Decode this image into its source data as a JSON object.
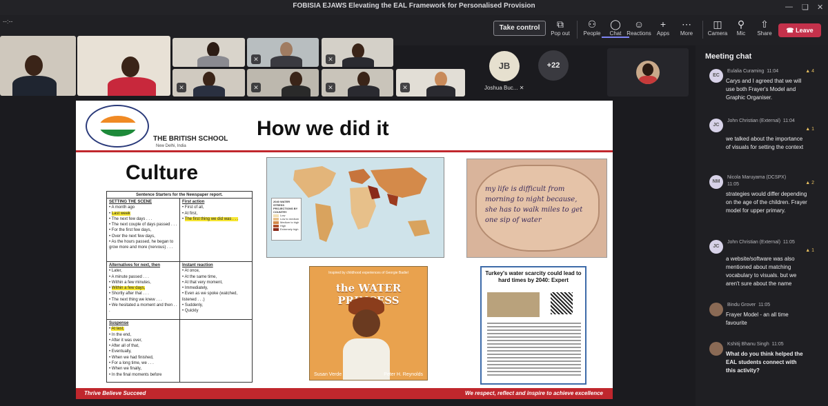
{
  "window": {
    "title": "FOBISIA EJAWS Elevating the EAL Framework for Personalised Provision",
    "timer": "--:--"
  },
  "toolbar": {
    "take_control": "Take control",
    "popout": "Pop out",
    "people": "People",
    "chat": "Chat",
    "reactions": "Reactions",
    "apps": "Apps",
    "more": "More",
    "camera": "Camera",
    "mic": "Mic",
    "share": "Share",
    "leave": "Leave"
  },
  "participants": {
    "jb_initials": "JB",
    "jb_name": "Joshua Buc...",
    "overflow_count": "+22"
  },
  "slide": {
    "school_name": "THE BRITISH SCHOOL",
    "school_location": "New Delhi, India",
    "title": "How we did it",
    "section": "Culture",
    "starters_header": "Sentence Starters for the Newspaper report.",
    "cells": {
      "setting_scene_title": "SETTING THE SCENE",
      "setting_scene_items": [
        "A month ago",
        "Last week",
        "The next few days . . .",
        "The next couple of days passed . . .",
        "For the first few days,",
        "Over the next few days,",
        "As the hours passed, he began to grow more and more (nervous) . . ."
      ],
      "first_action_title": "First action",
      "first_action_items": [
        "First of all,",
        "At first,",
        "The first thing we did was . . ."
      ],
      "alternatives_title": "Alternatives for next, then",
      "alternatives_items": [
        "Later,",
        "A minute passed . . .",
        "Within a few minutes,",
        "Within a few days,",
        "Shortly after that . . .",
        "The next thing we knew . . .",
        "We hesitated a moment and then . . ."
      ],
      "instant_title": "Instant reaction",
      "instant_items": [
        "At once,",
        "At the same time,",
        "At that very moment,",
        "Immediately,",
        "Even as we spoke (watched, listened . . .)",
        "Suddenly,",
        "Quickly"
      ],
      "suspense_title": "Suspense",
      "suspense_items": [
        "At last,",
        "In the end,",
        "After it was over,",
        "After all of that,",
        "Eventually,",
        "When we had finished,",
        "For a long time, we . . .",
        "When we finally,",
        "In the final moments before"
      ]
    },
    "map_legend_title": "2040 WATER STRESS PROJECTIONS BY COUNTRY",
    "map_legend_items": [
      "Low",
      "Low to medium",
      "Medium to high",
      "High",
      "Extremely high"
    ],
    "pot_text": "my life is difficult from morning to night because, she has to walk miles to get one sip of water",
    "book_subtitle": "Inspired by childhood experiences of Georgie Badiel",
    "book_title": "the WATER PRINCESS",
    "book_author": "Susan Verde",
    "book_illustrator": "Peter H. Reynolds",
    "article_title": "Turkey's water scarcity could lead to hard times by 2040: Expert",
    "footer_left": "Thrive Believe Succeed",
    "footer_right": "We respect, reflect and inspire to achieve excellence"
  },
  "chat": {
    "title": "Meeting chat",
    "messages": [
      {
        "initials": "EC",
        "sender": "Eulalia Curaming",
        "time": "11:04",
        "reaction": "4",
        "text": "Carys and I agreed that we will use both Frayer's Model and Graphic Organiser."
      },
      {
        "initials": "JC",
        "sender": "John Christian (External)",
        "time": "11:04",
        "reaction": "1",
        "text": "we talked about the importance of visuals for setting the context"
      },
      {
        "initials": "NM",
        "sender": "Nicola Maruyama (DCSPX)",
        "time": "11:05",
        "reaction": "2",
        "text": "strategies would differ depending on the age of the children. Frayer model for upper primary."
      },
      {
        "initials": "JC",
        "sender": "John Christian (External)",
        "time": "11:05",
        "reaction": "1",
        "text": "a website/software was also mentioned about matching vocabulary to visuals. but we aren't sure about the name"
      },
      {
        "initials": "",
        "sender": "Bindu Grover",
        "time": "11:05",
        "reaction": "",
        "text": "Frayer Model - an all time favourite"
      },
      {
        "initials": "",
        "sender": "Kshitij Bhanu Singh",
        "time": "11:05",
        "reaction": "",
        "text": "What do you think helped the EAL students connect with this activity?"
      }
    ]
  }
}
